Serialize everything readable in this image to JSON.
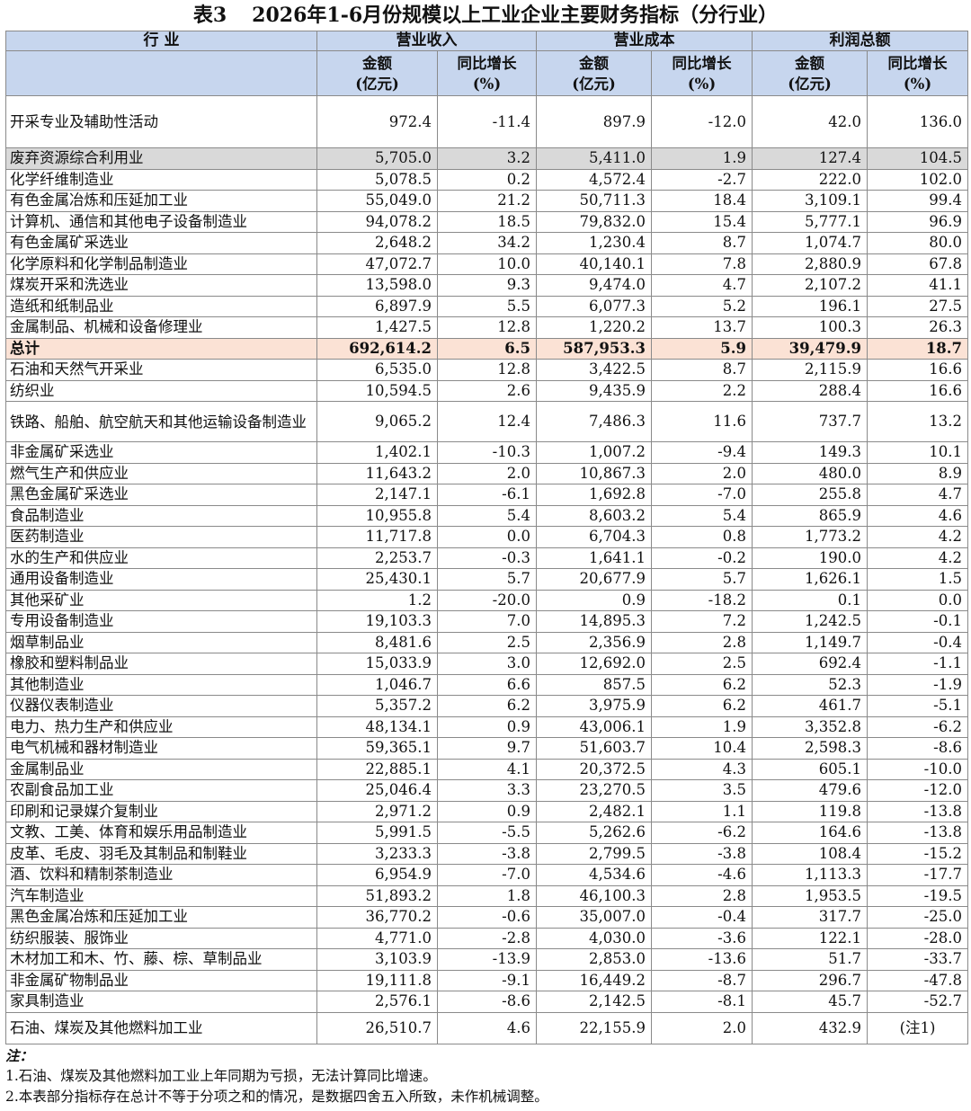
{
  "title": {
    "label": "表3",
    "text": "2026年1-6月份规模以上工业企业主要财务指标（分行业）"
  },
  "header": {
    "industry": "行  业",
    "groups": [
      "营业收入",
      "营业成本",
      "利润总额"
    ],
    "sub": [
      "金额\n(亿元)",
      "同比增长\n(%)",
      "金额\n(亿元)",
      "同比增长\n(%)",
      "金额\n(亿元)",
      "同比增长\n(%)"
    ]
  },
  "rows": [
    {
      "name": "开采专业及辅助性活动",
      "v": [
        "972.4",
        "-11.4",
        "897.9",
        "-12.0",
        "42.0",
        "136.0"
      ]
    },
    {
      "name": "废弃资源综合利用业",
      "v": [
        "5,705.0",
        "3.2",
        "5,411.0",
        "1.9",
        "127.4",
        "104.5"
      ]
    },
    {
      "name": "化学纤维制造业",
      "v": [
        "5,078.5",
        "0.2",
        "4,572.4",
        "-2.7",
        "222.0",
        "102.0"
      ]
    },
    {
      "name": "有色金属冶炼和压延加工业",
      "v": [
        "55,049.0",
        "21.2",
        "50,711.3",
        "18.4",
        "3,109.1",
        "99.4"
      ]
    },
    {
      "name": "计算机、通信和其他电子设备制造业",
      "v": [
        "94,078.2",
        "18.5",
        "79,832.0",
        "15.4",
        "5,777.1",
        "96.9"
      ]
    },
    {
      "name": "有色金属矿采选业",
      "v": [
        "2,648.2",
        "34.2",
        "1,230.4",
        "8.7",
        "1,074.7",
        "80.0"
      ]
    },
    {
      "name": "化学原料和化学制品制造业",
      "v": [
        "47,072.7",
        "10.0",
        "40,140.1",
        "7.8",
        "2,880.9",
        "67.8"
      ]
    },
    {
      "name": "煤炭开采和洗选业",
      "v": [
        "13,598.0",
        "9.3",
        "9,474.0",
        "4.7",
        "2,107.2",
        "41.1"
      ]
    },
    {
      "name": "造纸和纸制品业",
      "v": [
        "6,897.9",
        "5.5",
        "6,077.3",
        "5.2",
        "196.1",
        "27.5"
      ]
    },
    {
      "name": "金属制品、机械和设备修理业",
      "v": [
        "1,427.5",
        "12.8",
        "1,220.2",
        "13.7",
        "100.3",
        "26.3"
      ]
    },
    {
      "name": "总计",
      "v": [
        "692,614.2",
        "6.5",
        "587,953.3",
        "5.9",
        "39,479.9",
        "18.7"
      ]
    },
    {
      "name": "石油和天然气开采业",
      "v": [
        "6,535.0",
        "12.8",
        "3,422.5",
        "8.7",
        "2,115.9",
        "16.6"
      ]
    },
    {
      "name": "纺织业",
      "v": [
        "10,594.5",
        "2.6",
        "9,435.9",
        "2.2",
        "288.4",
        "16.6"
      ]
    },
    {
      "name": "铁路、船舶、航空航天和其他运输设备制造业",
      "v": [
        "9,065.2",
        "12.4",
        "7,486.3",
        "11.6",
        "737.7",
        "13.2"
      ]
    },
    {
      "name": "非金属矿采选业",
      "v": [
        "1,402.1",
        "-10.3",
        "1,007.2",
        "-9.4",
        "149.3",
        "10.1"
      ]
    },
    {
      "name": "燃气生产和供应业",
      "v": [
        "11,643.2",
        "2.0",
        "10,867.3",
        "2.0",
        "480.0",
        "8.9"
      ]
    },
    {
      "name": "黑色金属矿采选业",
      "v": [
        "2,147.1",
        "-6.1",
        "1,692.8",
        "-7.0",
        "255.8",
        "4.7"
      ]
    },
    {
      "name": "食品制造业",
      "v": [
        "10,955.8",
        "5.4",
        "8,603.2",
        "5.4",
        "865.9",
        "4.6"
      ]
    },
    {
      "name": "医药制造业",
      "v": [
        "11,717.8",
        "0.0",
        "6,704.3",
        "0.8",
        "1,773.2",
        "4.2"
      ]
    },
    {
      "name": "水的生产和供应业",
      "v": [
        "2,253.7",
        "-0.3",
        "1,641.1",
        "-0.2",
        "190.0",
        "4.2"
      ]
    },
    {
      "name": "通用设备制造业",
      "v": [
        "25,430.1",
        "5.7",
        "20,677.9",
        "5.7",
        "1,626.1",
        "1.5"
      ]
    },
    {
      "name": "其他采矿业",
      "v": [
        "1.2",
        "-20.0",
        "0.9",
        "-18.2",
        "0.1",
        "0.0"
      ]
    },
    {
      "name": "专用设备制造业",
      "v": [
        "19,103.3",
        "7.0",
        "14,895.3",
        "7.2",
        "1,242.5",
        "-0.1"
      ]
    },
    {
      "name": "烟草制品业",
      "v": [
        "8,481.6",
        "2.5",
        "2,356.9",
        "2.8",
        "1,149.7",
        "-0.4"
      ]
    },
    {
      "name": "橡胶和塑料制品业",
      "v": [
        "15,033.9",
        "3.0",
        "12,692.0",
        "2.5",
        "692.4",
        "-1.1"
      ]
    },
    {
      "name": "其他制造业",
      "v": [
        "1,046.7",
        "6.6",
        "857.5",
        "6.2",
        "52.3",
        "-1.9"
      ]
    },
    {
      "name": "仪器仪表制造业",
      "v": [
        "5,357.2",
        "6.2",
        "3,975.9",
        "6.2",
        "461.7",
        "-5.1"
      ]
    },
    {
      "name": "电力、热力生产和供应业",
      "v": [
        "48,134.1",
        "0.9",
        "43,006.1",
        "1.9",
        "3,352.8",
        "-6.2"
      ]
    },
    {
      "name": "电气机械和器材制造业",
      "v": [
        "59,365.1",
        "9.7",
        "51,603.7",
        "10.4",
        "2,598.3",
        "-8.6"
      ]
    },
    {
      "name": "金属制品业",
      "v": [
        "22,885.1",
        "4.1",
        "20,372.5",
        "4.3",
        "605.1",
        "-10.0"
      ]
    },
    {
      "name": "农副食品加工业",
      "v": [
        "25,046.4",
        "3.3",
        "23,270.5",
        "3.5",
        "479.6",
        "-12.0"
      ]
    },
    {
      "name": "印刷和记录媒介复制业",
      "v": [
        "2,971.2",
        "0.9",
        "2,482.1",
        "1.1",
        "119.8",
        "-13.8"
      ]
    },
    {
      "name": "文教、工美、体育和娱乐用品制造业",
      "v": [
        "5,991.5",
        "-5.5",
        "5,262.6",
        "-6.2",
        "164.6",
        "-13.8"
      ]
    },
    {
      "name": "皮革、毛皮、羽毛及其制品和制鞋业",
      "v": [
        "3,233.3",
        "-3.8",
        "2,799.5",
        "-3.8",
        "108.4",
        "-15.2"
      ]
    },
    {
      "name": "酒、饮料和精制茶制造业",
      "v": [
        "6,954.9",
        "-7.0",
        "4,534.6",
        "-4.6",
        "1,113.3",
        "-17.7"
      ]
    },
    {
      "name": "汽车制造业",
      "v": [
        "51,893.2",
        "1.8",
        "46,100.3",
        "2.8",
        "1,953.5",
        "-19.5"
      ]
    },
    {
      "name": "黑色金属冶炼和压延加工业",
      "v": [
        "36,770.2",
        "-0.6",
        "35,007.0",
        "-0.4",
        "317.7",
        "-25.0"
      ]
    },
    {
      "name": "纺织服装、服饰业",
      "v": [
        "4,771.0",
        "-2.8",
        "4,030.0",
        "-3.6",
        "122.1",
        "-28.0"
      ]
    },
    {
      "name": "木材加工和木、竹、藤、棕、草制品业",
      "v": [
        "3,103.9",
        "-13.9",
        "2,853.0",
        "-13.6",
        "51.7",
        "-33.7"
      ]
    },
    {
      "name": "非金属矿物制品业",
      "v": [
        "19,111.8",
        "-9.1",
        "16,449.2",
        "-8.7",
        "296.7",
        "-47.8"
      ]
    },
    {
      "name": "家具制造业",
      "v": [
        "2,576.1",
        "-8.6",
        "2,142.5",
        "-8.1",
        "45.7",
        "-52.7"
      ]
    },
    {
      "name": "石油、煤炭及其他燃料加工业",
      "v": [
        "26,510.7",
        "4.6",
        "22,155.9",
        "2.0",
        "432.9",
        "(注1)"
      ]
    }
  ],
  "notes": {
    "title": "注：",
    "items": [
      "1.石油、煤炭及其他燃料加工业上年同期为亏损，无法计算同比增速。",
      "2.本表部分指标存在总计不等于分项之和的情况，是数据四舍五入所致，未作机械调整。"
    ]
  },
  "colors": {
    "header_bg": "#c7d6ee",
    "total_bg": "#fbe2d5",
    "highlight_bg": "#d9d9d9",
    "border": "#8a8a8a"
  }
}
